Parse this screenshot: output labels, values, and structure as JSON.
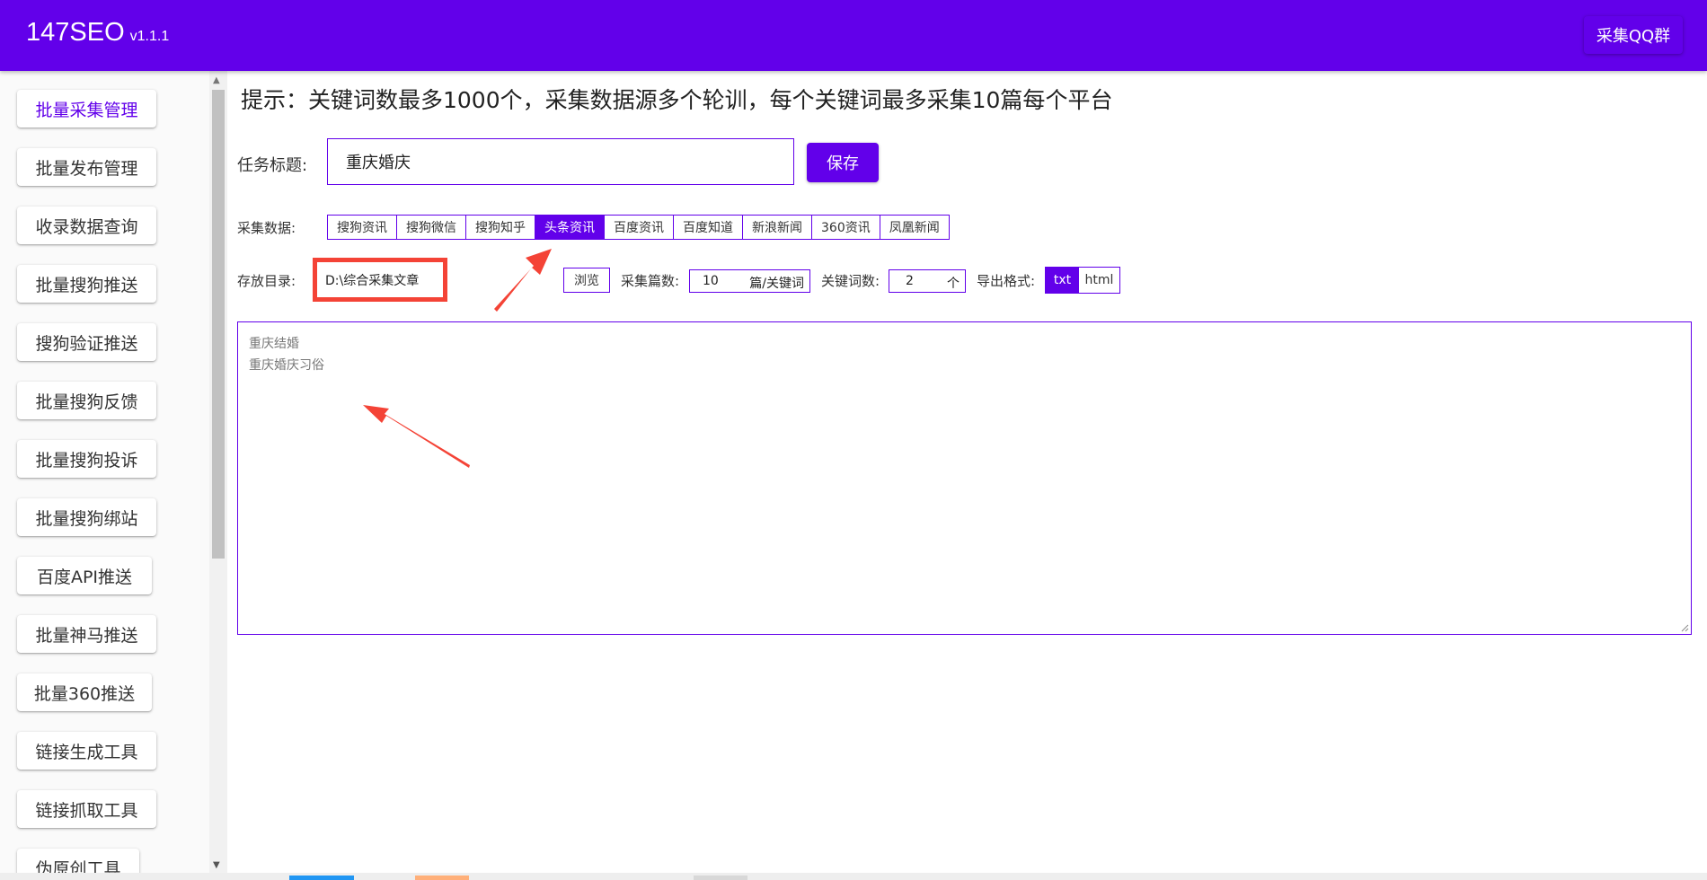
{
  "header": {
    "app_name": "147SEO",
    "version": "v1.1.1",
    "qq_button": "采集QQ群",
    "bg_color": "#6200ea"
  },
  "sidebar": {
    "items": [
      {
        "label": "批量采集管理",
        "active": true
      },
      {
        "label": "批量发布管理"
      },
      {
        "label": "收录数据查询"
      },
      {
        "label": "批量搜狗推送"
      },
      {
        "label": "搜狗验证推送"
      },
      {
        "label": "批量搜狗反馈"
      },
      {
        "label": "批量搜狗投诉"
      },
      {
        "label": "批量搜狗绑站"
      },
      {
        "label": "百度API推送"
      },
      {
        "label": "批量神马推送"
      },
      {
        "label": "批量360推送"
      },
      {
        "label": "链接生成工具"
      },
      {
        "label": "链接抓取工具"
      },
      {
        "label": "伪原创工具"
      }
    ]
  },
  "main": {
    "hint": "提示：关键词数最多1000个，采集数据源多个轮训，每个关键词最多采集10篇每个平台",
    "task_title_label": "任务标题:",
    "task_title_value": "重庆婚庆",
    "save_button": "保存",
    "source_label": "采集数据:",
    "sources": [
      {
        "label": "搜狗资讯"
      },
      {
        "label": "搜狗微信"
      },
      {
        "label": "搜狗知乎"
      },
      {
        "label": "头条资讯",
        "selected": true
      },
      {
        "label": "百度资讯"
      },
      {
        "label": "百度知道"
      },
      {
        "label": "新浪新闻"
      },
      {
        "label": "360资讯"
      },
      {
        "label": "凤凰新闻"
      }
    ],
    "dir_label": "存放目录:",
    "dir_value": "D:\\综合采集文章",
    "browse_button": "浏览",
    "count_label": "采集篇数:",
    "count_value": "10",
    "count_unit": "篇/关键词",
    "keyword_count_label": "关键词数:",
    "keyword_count_value": "2",
    "keyword_count_unit": "个",
    "format_label": "导出格式:",
    "formats": [
      {
        "label": "txt",
        "selected": true
      },
      {
        "label": "html"
      }
    ],
    "keywords": [
      "重庆结婚",
      "重庆婚庆习俗"
    ]
  },
  "colors": {
    "accent": "#6200ea",
    "annotation_red": "#f44336"
  }
}
